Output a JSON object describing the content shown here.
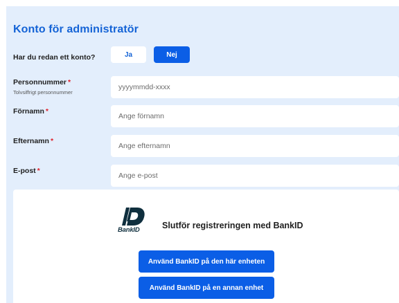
{
  "form": {
    "title": "Konto för administratör",
    "has_account": {
      "label": "Har du redan ett konto?",
      "yes_label": "Ja",
      "no_label": "Nej",
      "selected": "Nej"
    },
    "personal_number": {
      "label": "Personnummer",
      "required_mark": "*",
      "hint": "Tolvsiffrigt personnummer",
      "placeholder": "yyyymmdd-xxxx",
      "value": ""
    },
    "first_name": {
      "label": "Förnamn",
      "required_mark": "*",
      "placeholder": "Ange förnamn",
      "value": ""
    },
    "last_name": {
      "label": "Efternamn",
      "required_mark": "*",
      "placeholder": "Ange efternamn",
      "value": ""
    },
    "email": {
      "label": "E-post",
      "required_mark": "*",
      "placeholder": "Ange e-post",
      "value": ""
    }
  },
  "bankid": {
    "logo_text": "BankID",
    "title": "Slutför registreringen med BankID",
    "this_device_label": "Använd BankID på den här enheten",
    "other_device_label": "Använd BankID på en annan enhet"
  },
  "colors": {
    "accent": "#0b5ee6",
    "title_blue": "#1463d6",
    "background": "#e3eefc",
    "required": "#e0212c",
    "bankid_dark": "#0f2f3e"
  }
}
